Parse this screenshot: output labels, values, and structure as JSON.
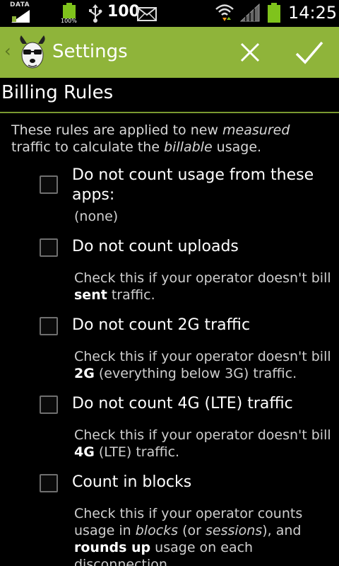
{
  "status_bar": {
    "data_label": "DATA",
    "battery_small_label": "100%",
    "battery_percent": "100",
    "time": "14:25",
    "icons": [
      "data-icon",
      "battery-icon",
      "usb-icon",
      "mail-icon",
      "wifi-icon",
      "signal-icon",
      "battery-icon"
    ]
  },
  "action_bar": {
    "title": "Settings",
    "color": "#8fb43a"
  },
  "section": {
    "header": "Billing Rules",
    "intro_1": "These rules are applied to new ",
    "intro_measured": "measured",
    "intro_2": " traffic to calculate the ",
    "intro_billable": "billable",
    "intro_3": " usage."
  },
  "rules": [
    {
      "title": "Do not count usage from these apps:",
      "summary": "(none)",
      "checked": false
    },
    {
      "title": "Do not count uploads",
      "summary_a": "Check this if your operator doesn't bill ",
      "summary_b": "sent",
      "summary_c": " traffic.",
      "checked": false
    },
    {
      "title": "Do not count 2G traffic",
      "summary_a": "Check this if your operator doesn't bill ",
      "summary_b": "2G",
      "summary_c": " (everything below 3G) traffic.",
      "checked": false
    },
    {
      "title": "Do not count 4G (LTE) traffic",
      "summary_a": "Check this if your operator doesn't bill ",
      "summary_b": "4G",
      "summary_c": " (LTE) traffic.",
      "checked": false
    },
    {
      "title": "Count in blocks",
      "summary_a": "Check this if your operator counts usage in ",
      "summary_b": "blocks",
      "summary_c": " (or ",
      "summary_d": "sessions",
      "summary_e": "), and ",
      "summary_f": "rounds up",
      "summary_g": " usage on each disconnection.",
      "checked": false
    }
  ]
}
